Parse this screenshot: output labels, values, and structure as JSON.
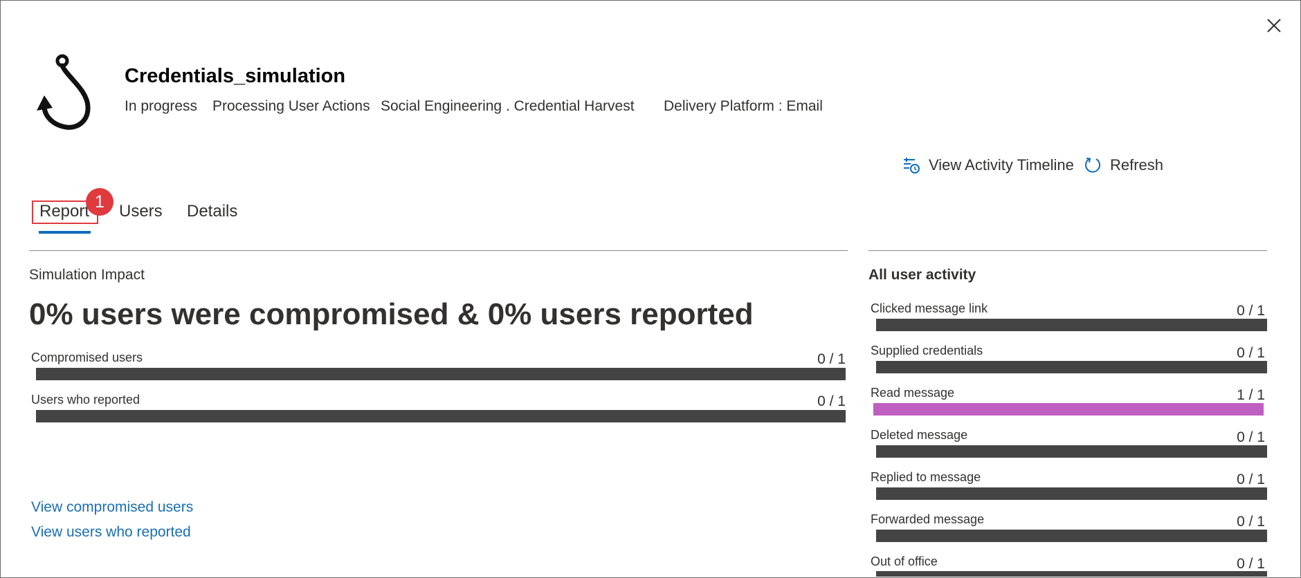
{
  "header": {
    "title": "Credentials_simulation",
    "meta": [
      "In progress",
      "Processing User Actions",
      "Social Engineering . Credential Harvest",
      "Delivery Platform : Email"
    ]
  },
  "toolbar": {
    "view_timeline_label": "View Activity Timeline",
    "refresh_label": "Refresh"
  },
  "tabs": [
    {
      "label": "Report",
      "selected": true
    },
    {
      "label": "Users",
      "selected": false
    },
    {
      "label": "Details",
      "selected": false
    }
  ],
  "annotation_badge": "1",
  "simulation_impact": {
    "title": "Simulation Impact",
    "headline": "0% users were compromised & 0% users reported",
    "rows": [
      {
        "label": "Compromised users",
        "value": "0 / 1"
      },
      {
        "label": "Users who reported",
        "value": "0 / 1"
      }
    ],
    "links": [
      "View compromised users",
      "View users who reported"
    ]
  },
  "all_user_activity": {
    "title": "All user activity",
    "rows": [
      {
        "label": "Clicked message link",
        "value": "0 / 1"
      },
      {
        "label": "Supplied credentials",
        "value": "0 / 1"
      },
      {
        "label": "Read message",
        "value": "1 / 1"
      },
      {
        "label": "Deleted message",
        "value": "0 / 1"
      },
      {
        "label": "Replied to message",
        "value": "0 / 1"
      },
      {
        "label": "Forwarded message",
        "value": "0 / 1"
      },
      {
        "label": "Out of office",
        "value": "0 / 1"
      }
    ]
  },
  "colors": {
    "accent": "#0f6cbd",
    "highlight": "#e03a3e",
    "bar_default": "#444444",
    "bar_read": "#c05fc2",
    "link": "#1a6fb3"
  }
}
